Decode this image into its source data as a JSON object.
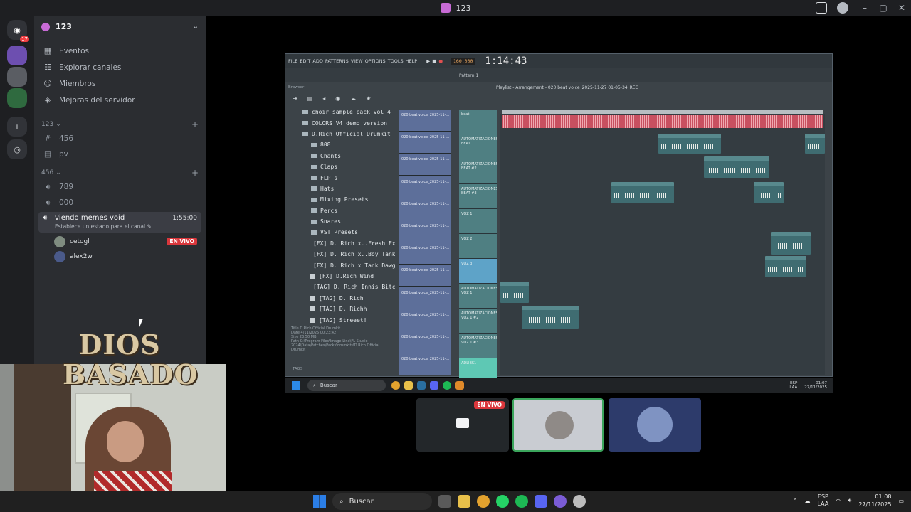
{
  "window": {
    "title": "123"
  },
  "guild": {
    "name": "123"
  },
  "menu": [
    {
      "icon": "calendar-icon",
      "label": "Eventos"
    },
    {
      "icon": "compass-icon",
      "label": "Explorar canales"
    },
    {
      "icon": "members-icon",
      "label": "Miembros"
    },
    {
      "icon": "boost-icon",
      "label": "Mejoras del servidor"
    }
  ],
  "categories": [
    {
      "name": "123",
      "channels": [
        {
          "type": "text",
          "name": "456"
        },
        {
          "type": "text",
          "name": "pv"
        }
      ]
    },
    {
      "name": "456",
      "channels": [
        {
          "type": "voice",
          "name": "789"
        },
        {
          "type": "voice",
          "name": "000"
        }
      ]
    }
  ],
  "active_voice": {
    "name": "viendo memes void",
    "duration": "1:55:00",
    "status_hint": "Establece un estado para el canal",
    "users": [
      {
        "name": "cetogl",
        "live": "EN VIVO"
      },
      {
        "name": "alex2w"
      }
    ]
  },
  "server_badge": "17",
  "fl_studio": {
    "menus": [
      "FILE",
      "EDIT",
      "ADD",
      "PATTERNS",
      "VIEW",
      "OPTIONS",
      "TOOLS",
      "HELP"
    ],
    "tempo": "160.000",
    "time": "1:14:43",
    "pattern": "Pattern 1",
    "browser_title": "Browser",
    "playlist_title": "Playlist - Arrangement - 020 beat voice_2025-11-27 01-05-34_REC",
    "browser_items": [
      {
        "kind": "folder",
        "label": "choir sample pack vol 4"
      },
      {
        "kind": "folder",
        "label": "COLORS V4 demo version"
      },
      {
        "kind": "folder",
        "label": "D.Rich Official Drumkit"
      },
      {
        "kind": "folder",
        "label": "808"
      },
      {
        "kind": "folder",
        "label": "Chants"
      },
      {
        "kind": "folder",
        "label": "Claps"
      },
      {
        "kind": "folder",
        "label": "FLP_s"
      },
      {
        "kind": "folder",
        "label": "Hats"
      },
      {
        "kind": "folder",
        "label": "Mixing Presets"
      },
      {
        "kind": "folder",
        "label": "Percs"
      },
      {
        "kind": "folder",
        "label": "Snares"
      },
      {
        "kind": "folder",
        "label": "VST Presets"
      },
      {
        "kind": "file",
        "label": "[FX] D. Rich x..Fresh Explosion"
      },
      {
        "kind": "file",
        "label": "[FX] D. Rich x..Boy Tank Riser"
      },
      {
        "kind": "file",
        "label": "[FX] D. Rich x Tank Dawgs"
      },
      {
        "kind": "file",
        "label": "[FX] D.Rich Wind"
      },
      {
        "kind": "file",
        "label": "[TAG] D. Rich Innis Bitch!"
      },
      {
        "kind": "file",
        "label": "[TAG] D. Rich"
      },
      {
        "kind": "file",
        "label": "[TAG] D. Richh"
      },
      {
        "kind": "file",
        "label": "[TAG] Streeet!"
      }
    ],
    "info": {
      "title_label": "Title",
      "title_value": "D.Rich Official Drumkit",
      "date_label": "Date",
      "date_value": "4/11/2025 00:23:42",
      "size_label": "Size",
      "size_value": "23.50 MB",
      "path_label": "Path",
      "path_value": "C:\\Program Files\\Image-Line\\FL Studio 2024\\Data\\Patches\\Packs\\drumkits\\D.Rich Official Drumkit"
    },
    "tags_label": "TAGS",
    "channel_clip": "020 beat voice_2025-11-...",
    "tracks": [
      "beat",
      "AUTOMATIZACIONES BEAT",
      "AUTOMATIZACIONES BEAT #2",
      "AUTOMATIZACIONES BEAT #3",
      "VOZ 1",
      "VOZ 2",
      "VOZ 3",
      "AUTOMATIZACIONES VOZ 1",
      "AUTOMATIZACIONES VOZ 1 #2",
      "AUTOMATIZACIONES VOZ 1 #3",
      "ADLIBS1"
    ],
    "taskbar_search": "Buscar",
    "tray_lang": "ESP",
    "tray_region": "LAA",
    "tray_time": "01:07",
    "tray_date": "27/11/2025"
  },
  "tile_live": "EN VIVO",
  "overlay": {
    "line1": "DIOS",
    "line2": "BASADO"
  },
  "taskbar": {
    "search_placeholder": "Buscar",
    "lang": "ESP",
    "region": "LAA",
    "time": "01:08",
    "date": "27/11/2025"
  }
}
